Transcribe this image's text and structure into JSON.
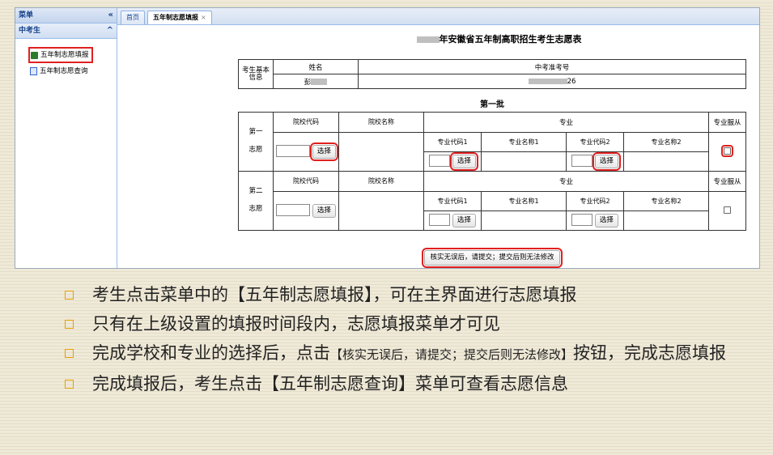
{
  "sidebar": {
    "title": "菜单",
    "collapse_icon": "«",
    "section": "中考生",
    "section_icon": "^",
    "items": [
      {
        "label": "五年制志愿填报",
        "icon": "edit-icon"
      },
      {
        "label": "五年制志愿查询",
        "icon": "doc-icon"
      }
    ]
  },
  "tabs": [
    {
      "label": "首页"
    },
    {
      "label": "五年制志愿填报",
      "close": "×"
    }
  ],
  "form": {
    "title": "年安徽省五年制高职招生考生志愿表",
    "basic_label": "考生基本信息",
    "name_header": "姓名",
    "exam_header": "中考准考号",
    "name_value": "彭",
    "exam_value": "26",
    "batch": "第一批",
    "choice1": "第一志愿",
    "choice2": "第二志愿",
    "school_code": "院校代码",
    "school_name": "院校名称",
    "major": "专业",
    "obey": "专业服从",
    "major_code1": "专业代码1",
    "major_name1": "专业名称1",
    "major_code2": "专业代码2",
    "major_name2": "专业名称2",
    "select": "选择",
    "submit": "核实无误后，请提交；提交后则无法修改"
  },
  "bullets": {
    "b1": "考生点击菜单中的【五年制志愿填报】，可在主界面进行志愿填报",
    "b2": "只有在上级设置的填报时间段内，志愿填报菜单才可见",
    "b3_pre": "完成学校和专业的选择后，点击",
    "b3_btn": "【核实无误后，请提交；提交后则无法修改】",
    "b3_post": "按钮，完成志愿填报",
    "b4": "完成填报后，考生点击【五年制志愿查询】菜单可查看志愿信息"
  }
}
